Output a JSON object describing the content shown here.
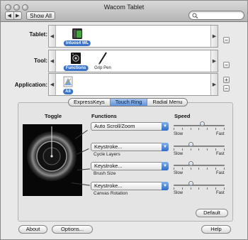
{
  "window": {
    "title": "Wacom Tablet"
  },
  "toolbar": {
    "show_all_label": "Show All",
    "search_placeholder": "",
    "search_value": ""
  },
  "rows": {
    "tablet": {
      "label": "Tablet:",
      "items": [
        {
          "name": "Intuos4 WL",
          "selected": true
        }
      ]
    },
    "tool": {
      "label": "Tool:",
      "items": [
        {
          "name": "Functions",
          "selected": true
        },
        {
          "name": "Grip Pen",
          "selected": false
        }
      ]
    },
    "application": {
      "label": "Application:",
      "items": [
        {
          "name": "All",
          "selected": true
        }
      ]
    }
  },
  "tabs": [
    {
      "label": "ExpressKeys",
      "active": false
    },
    {
      "label": "Touch Ring",
      "active": true
    },
    {
      "label": "Radial Menu",
      "active": false
    }
  ],
  "panel": {
    "toggle_header": "Toggle",
    "functions_header": "Functions",
    "speed_header": "Speed",
    "functions": [
      {
        "value": "Auto Scroll/Zoom",
        "sublabel": "",
        "speed": 0.55
      },
      {
        "value": "Keystroke...",
        "sublabel": "Cycle Layers",
        "speed": 0.33
      },
      {
        "value": "Keystroke...",
        "sublabel": "Brush Size",
        "speed": 0.33
      },
      {
        "value": "Keystroke...",
        "sublabel": "Canvas Rotation",
        "speed": 0.33
      }
    ],
    "slow_label": "Slow",
    "fast_label": "Fast",
    "default_label": "Default"
  },
  "footer": {
    "about_label": "About",
    "options_label": "Options...",
    "help_label": "Help"
  },
  "colors": {
    "accent": "#3b73c9",
    "ring_background": "#070707"
  }
}
